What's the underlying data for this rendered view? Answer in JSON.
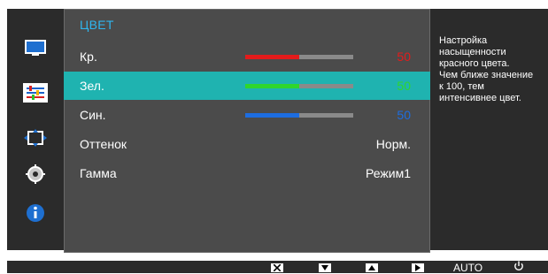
{
  "menu": {
    "title": "ЦВЕТ",
    "rows": [
      {
        "label": "Кр.",
        "value": "50",
        "level": 0.5,
        "color": "#e41b1b"
      },
      {
        "label": "Зел.",
        "value": "50",
        "level": 0.5,
        "color": "#2fd62c"
      },
      {
        "label": "Син.",
        "value": "50",
        "level": 0.5,
        "color": "#1d6de0"
      },
      {
        "label": "Оттенок",
        "value": "Норм."
      },
      {
        "label": "Гамма",
        "value": "Режим1"
      }
    ]
  },
  "help": {
    "text": "Настройка\nнасыщенности\nкрасного цвета.\nЧем ближе значение\nк 100, тем\nинтенсивнее цвет."
  },
  "bottom": {
    "auto_label": "AUTO"
  },
  "sidebar": {
    "icons": [
      "picture-icon",
      "color-adjust-icon",
      "position-size-icon",
      "settings-gear-icon",
      "info-icon"
    ]
  },
  "colors": {
    "title": "#2fb6ef",
    "selected_row": "#1fb3b0",
    "panel": "#4b4b4b",
    "frame": "#2b2b2b"
  }
}
